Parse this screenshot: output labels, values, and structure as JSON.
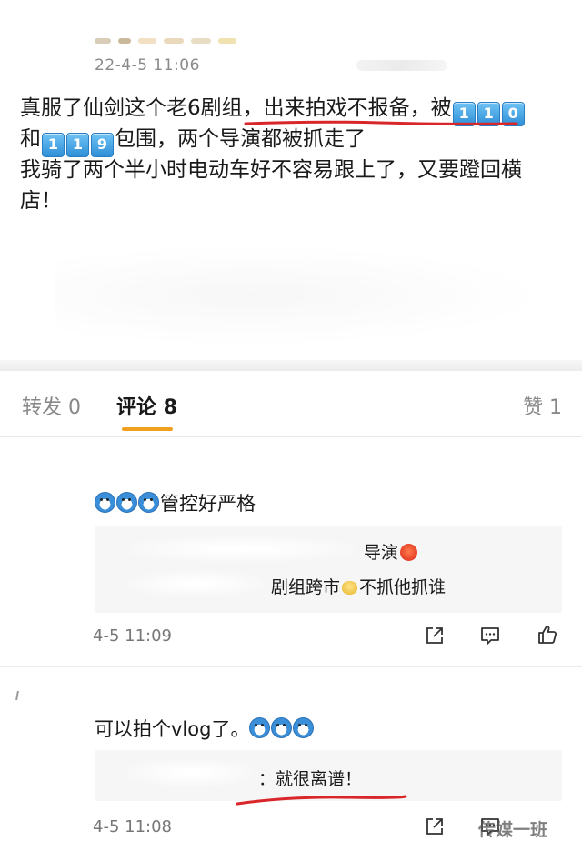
{
  "post": {
    "time": "22-4-5 11:06",
    "text": {
      "l1_a": "真服了仙剑这个老6剧组",
      "l1_b": "，出来拍戏不报备，",
      "l1_c": "被",
      "l2_a": "和",
      "l2_b": "包围，两个导演都被抓走了",
      "l3": "我骑了两个半小时电动车好不容易跟上了，又要蹬回横",
      "l4": "店！",
      "keycaps_110": [
        "1",
        "1",
        "0"
      ],
      "keycaps_119": [
        "1",
        "1",
        "9"
      ]
    }
  },
  "tabs": {
    "repost": "转发 0",
    "comment": "评论 8",
    "like": "赞 1"
  },
  "comments": [
    {
      "text": "管控好严格",
      "quote_l1": "导演",
      "quote_l2_a": "剧组跨市",
      "quote_l2_b": "不抓他抓谁",
      "time": "4-5 11:09"
    },
    {
      "text": "可以拍个vlog了。",
      "quote_l1": "：就很离谱！",
      "time": "4-5 11:08"
    }
  ],
  "watermark": "传媒一班",
  "colors": {
    "accent_underline": "#d8262a",
    "tab_indicator": "#f0a020",
    "keycap": "#3a9be0"
  }
}
